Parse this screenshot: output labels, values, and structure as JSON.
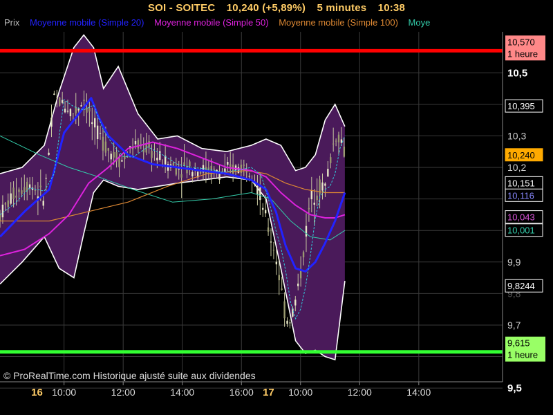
{
  "header": {
    "symbol": "SOI - SOITEC",
    "price": "10,240 (+5,89%)",
    "interval": "5 minutes",
    "time": "10:38"
  },
  "legend": [
    {
      "label": "Prix",
      "color": "#bbbbbb"
    },
    {
      "label": "Moyenne mobile (Simple 20)",
      "color": "#2222ff"
    },
    {
      "label": "Moyenne mobile (Simple 50)",
      "color": "#dd22dd"
    },
    {
      "label": "Moyenne mobile (Simple 100)",
      "color": "#dd8833"
    },
    {
      "label": "Moye",
      "color": "#33ccaa"
    }
  ],
  "footer": "© ProRealTime.com Historique ajusté suite aux dividendes",
  "colors": {
    "background": "#000000",
    "grid": "#3a3a3a",
    "candles": "#c8c8a0",
    "bollinger_fill": "#4a1a5a",
    "bollinger_border": "#ffffff",
    "sma20": "#2222ff",
    "sma50": "#dd22dd",
    "sma100": "#dd8833",
    "extra_ma": "#33ccaa",
    "resistance": "#ff0000",
    "support": "#33ff33"
  },
  "chart_data": {
    "type": "line",
    "title": "SOI - SOITEC 10,240 (+5,89%) 5 minutes 10:38",
    "ylim": [
      9.52,
      10.63
    ],
    "y_ticks": [
      "10,5",
      "10,3",
      "10,2",
      "9,9",
      "9,7",
      "9,5"
    ],
    "y_tick_values": [
      10.5,
      10.3,
      10.2,
      9.9,
      9.7,
      9.5
    ],
    "y_ticks_faint": [
      "9,8"
    ],
    "y_tick_values_faint": [
      9.8
    ],
    "x_day_labels": [
      "16",
      "17"
    ],
    "x_day_positions": [
      1,
      95
    ],
    "x_time_labels": [
      "10:00",
      "12:00",
      "14:00",
      "16:00",
      "10:00",
      "12:00",
      "14:00"
    ],
    "x_time_positions": [
      12,
      36,
      60,
      84,
      108,
      132,
      156
    ],
    "x_range": [
      -14,
      190
    ],
    "horizontal_lines": [
      {
        "label": "10,570",
        "sub": "1 heure",
        "value": 10.57,
        "color": "#ff0000",
        "tag_bg": "#ff8888",
        "tag_fg": "#000000"
      },
      {
        "label": "9,615",
        "sub": "1 heure",
        "value": 9.615,
        "color": "#33ff33",
        "tag_bg": "#99ff66",
        "tag_fg": "#000000"
      }
    ],
    "price_tags": [
      {
        "label": "10,395",
        "value": 10.395,
        "bg": "#000000",
        "fg": "#ffffff",
        "border": "#ffffff"
      },
      {
        "label": "10,240",
        "value": 10.24,
        "bg": "#ffaa00",
        "fg": "#000000",
        "border": "#ffaa00"
      },
      {
        "label": "10,151",
        "value": 10.151,
        "bg": "#000000",
        "fg": "#ffffff",
        "border": "#ffffff"
      },
      {
        "label": "10,116",
        "value": 10.116,
        "bg": "#000000",
        "fg": "#8888ff",
        "border": "#ffffff"
      },
      {
        "label": "10,043",
        "value": 10.043,
        "bg": "#000000",
        "fg": "#dd55dd",
        "border": "#ffffff"
      },
      {
        "label": "10,001",
        "value": 10.001,
        "bg": "#000000",
        "fg": "#33ccaa",
        "border": "#ffffff"
      },
      {
        "label": "9,8244",
        "value": 9.8244,
        "bg": "#000000",
        "fg": "#ffffff",
        "border": "#ffffff"
      }
    ],
    "series": [
      {
        "name": "Bollinger haut",
        "x": [
          -14,
          -5,
          4,
          10,
          16,
          20,
          24,
          28,
          34,
          42,
          50,
          58,
          68,
          78,
          88,
          94,
          100,
          106,
          110,
          114,
          118,
          122,
          126
        ],
        "values": [
          10.18,
          10.2,
          10.27,
          10.44,
          10.58,
          10.62,
          10.58,
          10.45,
          10.52,
          10.37,
          10.29,
          10.3,
          10.26,
          10.25,
          10.27,
          10.29,
          10.27,
          10.19,
          10.2,
          10.24,
          10.35,
          10.4,
          10.33
        ]
      },
      {
        "name": "Bollinger bas",
        "x": [
          -14,
          -5,
          4,
          10,
          16,
          20,
          24,
          28,
          34,
          42,
          50,
          58,
          68,
          78,
          88,
          94,
          100,
          106,
          110,
          114,
          118,
          122,
          126
        ],
        "values": [
          9.83,
          9.9,
          9.98,
          9.88,
          9.85,
          9.99,
          10.12,
          10.16,
          10.14,
          10.13,
          10.14,
          10.15,
          10.16,
          10.17,
          10.16,
          10.1,
          9.88,
          9.65,
          9.61,
          9.62,
          9.6,
          9.59,
          9.84
        ]
      },
      {
        "name": "Moyenne mobile (Simple 20)",
        "x": [
          -14,
          -4,
          6,
          12,
          18,
          23,
          26,
          30,
          38,
          48,
          58,
          68,
          78,
          88,
          94,
          98,
          102,
          106,
          110,
          114,
          118,
          122,
          126
        ],
        "values": [
          9.98,
          10.06,
          10.13,
          10.31,
          10.37,
          10.42,
          10.36,
          10.3,
          10.24,
          10.21,
          10.2,
          10.19,
          10.18,
          10.16,
          10.13,
          10.06,
          9.95,
          9.88,
          9.87,
          9.9,
          9.96,
          10.03,
          10.12
        ]
      },
      {
        "name": "Moyenne mobile (Simple 50)",
        "x": [
          -14,
          -4,
          6,
          14,
          22,
          30,
          38,
          48,
          58,
          68,
          78,
          88,
          94,
          100,
          106,
          112,
          118,
          122,
          126
        ],
        "values": [
          9.92,
          9.94,
          9.99,
          10.05,
          10.15,
          10.2,
          10.26,
          10.28,
          10.26,
          10.23,
          10.2,
          10.19,
          10.17,
          10.12,
          10.08,
          10.05,
          10.04,
          10.04,
          10.05
        ]
      },
      {
        "name": "Moyenne mobile (Simple 100)",
        "x": [
          -14,
          6,
          22,
          38,
          54,
          70,
          86,
          94,
          102,
          110,
          118,
          126
        ],
        "values": [
          10.03,
          10.03,
          10.06,
          10.09,
          10.14,
          10.18,
          10.19,
          10.18,
          10.15,
          10.13,
          10.12,
          10.12
        ]
      },
      {
        "name": "Moyenne mobile (autre)",
        "x": [
          -14,
          2,
          14,
          26,
          40,
          56,
          72,
          88,
          96,
          104,
          112,
          120,
          126
        ],
        "values": [
          10.3,
          10.24,
          10.2,
          10.17,
          10.13,
          10.09,
          10.1,
          10.12,
          10.1,
          10.03,
          9.98,
          9.97,
          10.0
        ]
      },
      {
        "name": "Prix",
        "x": [
          -14,
          -8,
          -2,
          4,
          8,
          12,
          16,
          20,
          24,
          28,
          32,
          36,
          40,
          46,
          52,
          58,
          64,
          70,
          76,
          82,
          88,
          92,
          95,
          98,
          100,
          102,
          104,
          106,
          108,
          110,
          112,
          114,
          116,
          118,
          120,
          122,
          124,
          126
        ],
        "values": [
          10.05,
          10.12,
          10.15,
          10.1,
          10.42,
          10.4,
          10.37,
          10.42,
          10.33,
          10.28,
          10.24,
          10.22,
          10.27,
          10.26,
          10.22,
          10.2,
          10.2,
          10.19,
          10.18,
          10.2,
          10.2,
          10.1,
          10.0,
          9.92,
          9.82,
          9.72,
          9.72,
          9.78,
          9.86,
          9.98,
          10.1,
          10.12,
          10.14,
          10.14,
          10.22,
          10.3,
          10.3,
          10.24
        ]
      }
    ]
  }
}
